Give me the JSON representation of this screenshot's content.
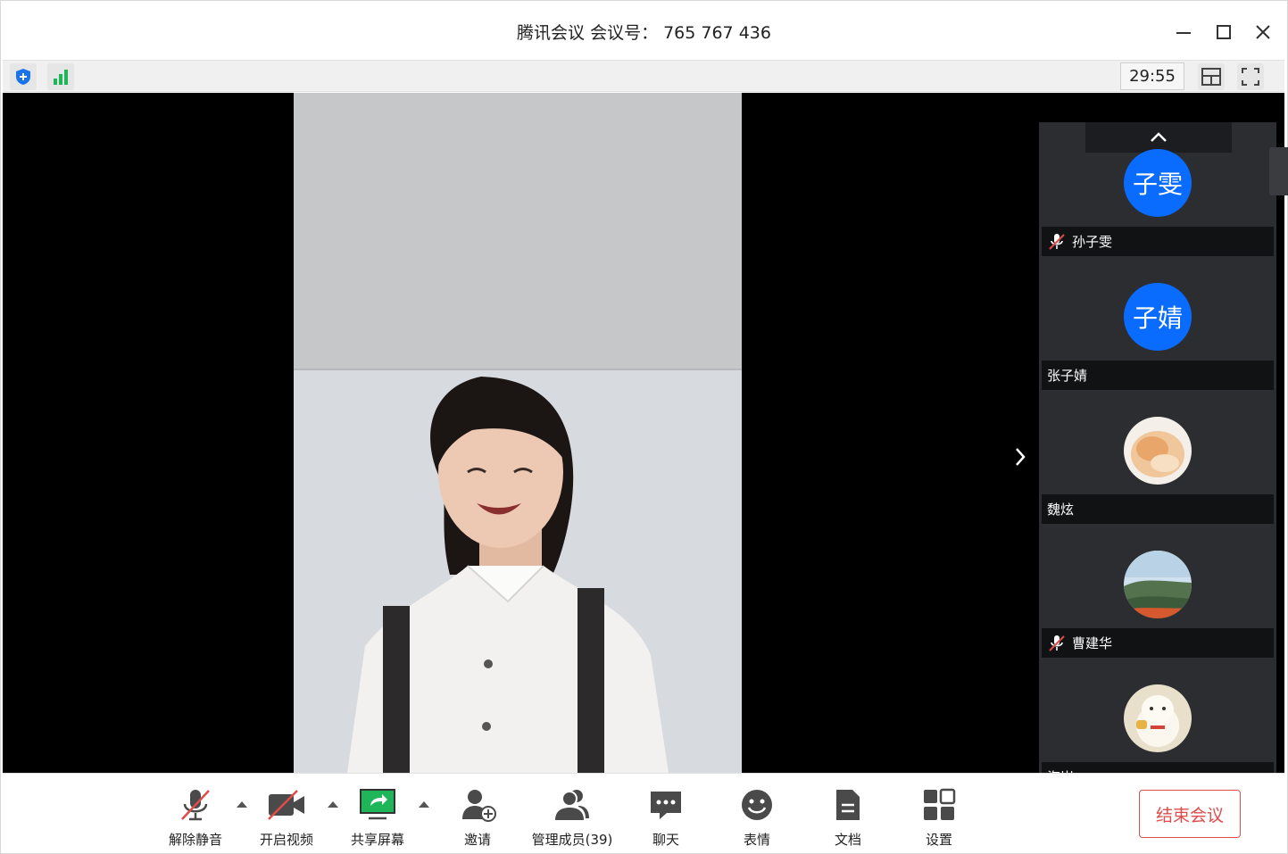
{
  "window": {
    "title_app": "腾讯会议",
    "title_meeting_label": "会议号：",
    "meeting_id": "765 767 436",
    "minimize_icon": "minimize-icon",
    "maximize_icon": "maximize-icon",
    "close_icon": "close-icon"
  },
  "subbar": {
    "security_icon": "shield-icon",
    "network_icon": "signal-bars-icon",
    "timer": "29:55",
    "layout_icon": "layout-icon",
    "fullscreen_icon": "fullscreen-icon",
    "security_color": "#1a73e8",
    "signal_color": "#1fb65a"
  },
  "participants": [
    {
      "name": "孙子雯",
      "avatar_text": "子雯",
      "muted": true,
      "avatar_color": "#0a6cff"
    },
    {
      "name": "张子婧",
      "avatar_text": "子婧",
      "muted": false,
      "avatar_color": "#0a6cff"
    },
    {
      "name": "魏炫",
      "avatar_text": "",
      "muted": false,
      "avatar_color": "#f0d3b5"
    },
    {
      "name": "曹建华",
      "avatar_text": "",
      "muted": true,
      "avatar_color": "#7a9d7a"
    },
    {
      "name": "海岸",
      "avatar_text": "",
      "muted": false,
      "avatar_color": "#e9e0cc"
    }
  ],
  "toolbar": {
    "unmute_label": "解除静音",
    "video_label": "开启视频",
    "share_label": "共享屏幕",
    "invite_label": "邀请",
    "members_label": "管理成员(39)",
    "chat_label": "聊天",
    "emoji_label": "表情",
    "docs_label": "文档",
    "settings_label": "设置",
    "end_label": "结束会议",
    "end_color": "#e04b4b",
    "share_color": "#1fb65a"
  }
}
